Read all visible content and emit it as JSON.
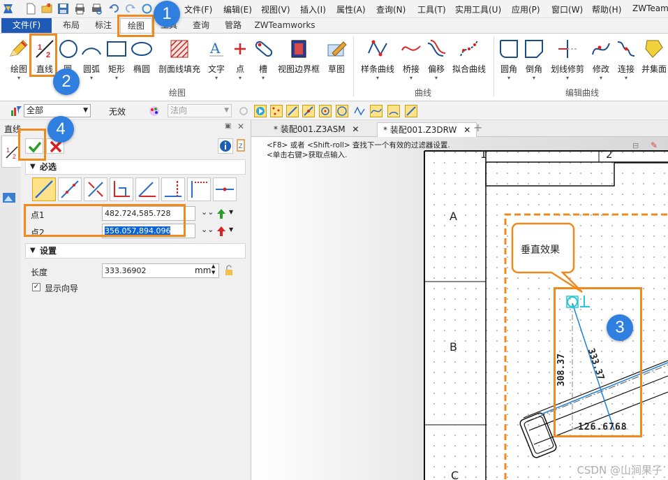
{
  "menubar": {
    "items": [
      "文件(F)",
      "编辑(E)",
      "视图(V)",
      "插入(I)",
      "属性(A)",
      "查询(N)",
      "工具(T)",
      "实用工具(U)",
      "应用(P)",
      "窗口(W)",
      "帮助(H)",
      "ZWTeamw"
    ]
  },
  "ribbon_tabs": [
    "文件(F)",
    "布局",
    "标注",
    "绘图",
    "工具",
    "查询",
    "管路",
    "ZWTeamworks"
  ],
  "ribbon": {
    "draw_group": [
      "绘图",
      "直线",
      "圆",
      "圆弧",
      "矩形",
      "椭圆",
      "剖面线填充",
      "文字",
      "点",
      "槽",
      "视图边界框",
      "草图"
    ],
    "draw_group_label": "绘图",
    "curve_group": [
      "样条曲线",
      "桥接",
      "偏移",
      "拟合曲线"
    ],
    "curve_group_label": "曲线",
    "edit_group": [
      "圆角",
      "倒角",
      "划线修剪",
      "修改",
      "连接",
      "并集面"
    ],
    "edit_group_label": "编辑曲线"
  },
  "filterbar": {
    "filter_value": "全部",
    "status": "无效",
    "direction_placeholder": "法向"
  },
  "leftpanel": {
    "title": "直线",
    "required_label": "必选",
    "point1_label": "点1",
    "point1_value": "482.724,585.728",
    "point2_label": "点2",
    "point2_value": "356.057,894.096",
    "settings_label": "设置",
    "length_label": "长度",
    "length_value": "333.36902",
    "length_unit": "mm",
    "show_guide_label": "显示向导"
  },
  "doctabs": [
    "* 装配001.Z3ASM",
    "* 装配001.Z3DRW"
  ],
  "canvas": {
    "hint_line1": "<F8> 或者 <Shift-roll> 查找下一个有效的过滤器设置.",
    "hint_line2": "<单击右键>获取点输入.",
    "col_labels": [
      "1",
      "2"
    ],
    "row_labels": [
      "A",
      "B",
      "C"
    ],
    "dim_vertical": "308.37",
    "dim_diagonal": "333.37",
    "dim_horizontal": "126.6768",
    "callout_text": "垂直效果"
  },
  "annotations": [
    "1",
    "2",
    "3",
    "4"
  ],
  "watermark": "CSDN @山涧果子",
  "colors": {
    "accent_blue": "#1f5bb5",
    "highlight_orange": "#f08a1e",
    "badge_blue": "#2f7fe0",
    "ok_green": "#2a9d2a",
    "cancel_red": "#d62020",
    "line_blue": "#1f7fe0",
    "guide_cyan": "#22c8d8"
  }
}
